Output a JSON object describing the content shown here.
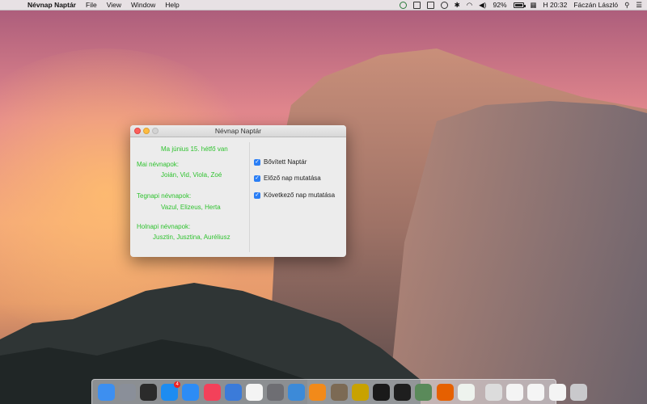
{
  "menubar": {
    "app_name": "Névnap Naptár",
    "menus": [
      "File",
      "View",
      "Window",
      "Help"
    ],
    "battery_percent": "92%",
    "clock": "H 20:32",
    "user": "Fáczán László"
  },
  "window": {
    "title": "Névnap Naptár",
    "today_heading": "Ma június 15. hétfő van",
    "today_label": "Mai névnapok:",
    "today_names": "Joián, Vid, Viola, Zoé",
    "yesterday_label": "Tegnapi névnapok:",
    "yesterday_names": "Vazul, Elizeus, Herta",
    "tomorrow_label": "Holnapi névnapok:",
    "tomorrow_names": "Jusztin, Jusztina, Auréliusz",
    "options": [
      {
        "label": "Bővített Naptár",
        "checked": true
      },
      {
        "label": "Előző nap mutatása",
        "checked": true
      },
      {
        "label": "Következő nap mutatása",
        "checked": true
      }
    ],
    "accent_color": "#2fc22f"
  },
  "dock": {
    "appstore_badge": "4",
    "items": [
      {
        "icon": "finder-icon",
        "color": "#3d8ff0"
      },
      {
        "icon": "launchpad-icon",
        "color": "#8a8f99"
      },
      {
        "icon": "mission-control-icon",
        "color": "#2b2b2b"
      },
      {
        "icon": "app-store-icon",
        "color": "#1d8cf0"
      },
      {
        "icon": "safari-icon",
        "color": "#2d8cf5"
      },
      {
        "icon": "itunes-icon",
        "color": "#f3415a"
      },
      {
        "icon": "xcode-icon",
        "color": "#3b7bd9"
      },
      {
        "icon": "photos-icon",
        "color": "#f4f4f4"
      },
      {
        "icon": "system-preferences-icon",
        "color": "#6e6e73"
      },
      {
        "icon": "onyx-icon",
        "color": "#3c8ad8"
      },
      {
        "icon": "vlc-icon",
        "color": "#f28a1a"
      },
      {
        "icon": "gimp-icon",
        "color": "#7c6a54"
      },
      {
        "icon": "dvd-player-icon",
        "color": "#c8a200"
      },
      {
        "icon": "terminal-icon",
        "color": "#1a1a1a"
      },
      {
        "icon": "activity-monitor-icon",
        "color": "#1e1e1e"
      },
      {
        "icon": "network-icon",
        "color": "#5a8a5a"
      },
      {
        "icon": "firefox-icon",
        "color": "#e66000"
      },
      {
        "icon": "numbers-icon",
        "color": "#eef3ee"
      },
      {
        "icon": "preview-icon",
        "color": "#dcdcdc"
      },
      {
        "icon": "notes-icon",
        "color": "#f4f4f4"
      },
      {
        "icon": "document-icon",
        "color": "#f5f5f5"
      },
      {
        "icon": "folder-icon",
        "color": "#f4f4f4"
      },
      {
        "icon": "trash-icon",
        "color": "#c9c9cc"
      }
    ]
  }
}
